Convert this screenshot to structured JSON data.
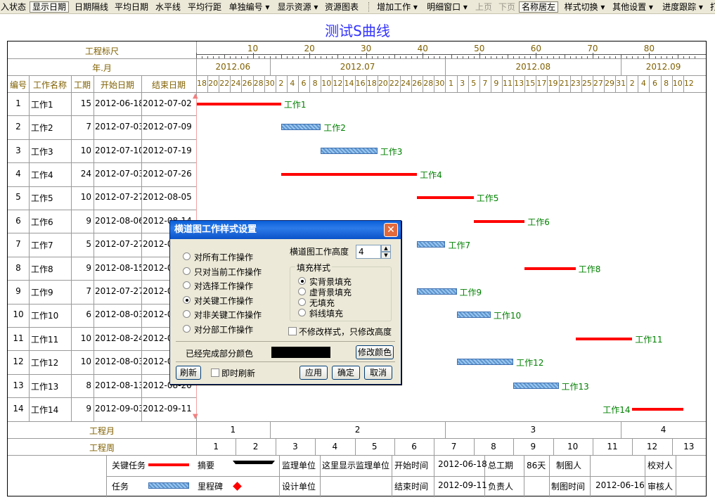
{
  "toolbar": {
    "items": [
      "入状态",
      "显示日期",
      "日期隔线",
      "平均日期",
      "水平线",
      "平均行距",
      "单独编号 ▾",
      "显示资源 ▾",
      "资源图表",
      "增加工作 ▾",
      "明细窗口 ▾",
      "上页",
      "下页",
      "名称居左",
      "样式切换 ▾",
      "其他设置 ▾",
      "进度跟踪 ▾",
      "打"
    ]
  },
  "title": "测试S曲线",
  "header": {
    "ruler_label": "工程标尺",
    "ym_label": "年.月",
    "ruler_ticks": [
      "10",
      "20",
      "30",
      "40",
      "50",
      "60",
      "70",
      "80"
    ],
    "months": [
      "2012.06",
      "2012.07",
      "2012.08",
      "2012.09"
    ],
    "days": [
      "18",
      "20",
      "22",
      "24",
      "26",
      "28",
      "30",
      "2",
      "4",
      "6",
      "8",
      "10",
      "12",
      "14",
      "16",
      "18",
      "20",
      "22",
      "24",
      "26",
      "28",
      "30",
      "1",
      "3",
      "5",
      "7",
      "9",
      "11",
      "13",
      "15",
      "17",
      "19",
      "21",
      "23",
      "25",
      "27",
      "29",
      "31",
      "2",
      "4",
      "6",
      "8",
      "10",
      "12"
    ],
    "columns": [
      "编号",
      "工作名称",
      "工期",
      "开始日期",
      "结束日期"
    ]
  },
  "tasks": [
    {
      "id": "1",
      "name": "工作1",
      "dur": "15",
      "start": "2012-06-18",
      "end": "2012-07-02",
      "label": "工作1"
    },
    {
      "id": "2",
      "name": "工作2",
      "dur": "7",
      "start": "2012-07-03",
      "end": "2012-07-09",
      "label": "工作2"
    },
    {
      "id": "3",
      "name": "工作3",
      "dur": "10",
      "start": "2012-07-10",
      "end": "2012-07-19",
      "label": "工作3"
    },
    {
      "id": "4",
      "name": "工作4",
      "dur": "24",
      "start": "2012-07-03",
      "end": "2012-07-26",
      "label": "工作4"
    },
    {
      "id": "5",
      "name": "工作5",
      "dur": "10",
      "start": "2012-07-27",
      "end": "2012-08-05",
      "label": "工作5"
    },
    {
      "id": "6",
      "name": "工作6",
      "dur": "9",
      "start": "2012-08-06",
      "end": "2012-08-14",
      "label": "工作6"
    },
    {
      "id": "7",
      "name": "工作7",
      "dur": "5",
      "start": "2012-07-27",
      "end": "2012-0",
      "label": "工作7"
    },
    {
      "id": "8",
      "name": "工作8",
      "dur": "9",
      "start": "2012-08-15",
      "end": "2012-0",
      "label": "工作8"
    },
    {
      "id": "9",
      "name": "工作9",
      "dur": "7",
      "start": "2012-07-27",
      "end": "2012-0",
      "label": "工作9"
    },
    {
      "id": "10",
      "name": "工作10",
      "dur": "6",
      "start": "2012-08-03",
      "end": "2012-0",
      "label": "工作10"
    },
    {
      "id": "11",
      "name": "工作11",
      "dur": "10",
      "start": "2012-08-24",
      "end": "2012-0",
      "label": "工作11"
    },
    {
      "id": "12",
      "name": "工作12",
      "dur": "10",
      "start": "2012-08-03",
      "end": "2012-0",
      "label": "工作12"
    },
    {
      "id": "13",
      "name": "工作13",
      "dur": "8",
      "start": "2012-08-13",
      "end": "2012-08-20",
      "label": "工作13"
    },
    {
      "id": "14",
      "name": "工作14",
      "dur": "9",
      "start": "2012-09-03",
      "end": "2012-09-11",
      "label": "工作14"
    }
  ],
  "footer": {
    "month_label": "工程月",
    "months": [
      "1",
      "2",
      "3",
      "4"
    ],
    "week_label": "工程周",
    "weeks": [
      "1",
      "2",
      "3",
      "4",
      "5",
      "6",
      "7",
      "8",
      "9",
      "10",
      "11",
      "12",
      "13"
    ],
    "legend": {
      "critical": "关键任务",
      "summary": "摘要",
      "task": "任务",
      "milestone": "里程碑"
    },
    "info": {
      "supervisor_label": "监理单位",
      "supervisor_value": "这里显示监理单位",
      "design_label": "设计单位",
      "start_label": "开始时间",
      "start_value": "2012-06-18",
      "end_label": "结束时间",
      "end_value": "2012-09-11",
      "total_label": "总工期",
      "total_value": "86天",
      "owner_label": "负责人",
      "drawer_label": "制图人",
      "draw_time_label": "制图时间",
      "draw_time_value": "2012-06-16",
      "checker_label": "校对人",
      "auditor_label": "审核人"
    }
  },
  "dialog": {
    "title": "横道图工作样式设置",
    "options": [
      "对所有工作操作",
      "只对当前工作操作",
      "对选择工作操作",
      "对关键工作操作",
      "对非关键工作操作",
      "对分部工作操作"
    ],
    "selected_option": 3,
    "height_label": "横道图工作高度",
    "height_value": "4",
    "fill_group": "填充样式",
    "fill_options": [
      "实背景填充",
      "虚背景填充",
      "无填充",
      "斜线填充"
    ],
    "selected_fill": 0,
    "no_change_label": "不修改样式，只修改高度",
    "done_color_label": "已经完成部分颜色",
    "done_color": "#000000",
    "modify_color_label": "修改颜色",
    "refresh_label": "刷新",
    "instant_label": "即时刷新",
    "apply_label": "应用",
    "ok_label": "确定",
    "cancel_label": "取消"
  },
  "colors": {
    "critical": "#ff0000",
    "task_fill": "#6fa8dc",
    "label": "#008000",
    "header_text": "#806000",
    "title": "#3333ff"
  }
}
